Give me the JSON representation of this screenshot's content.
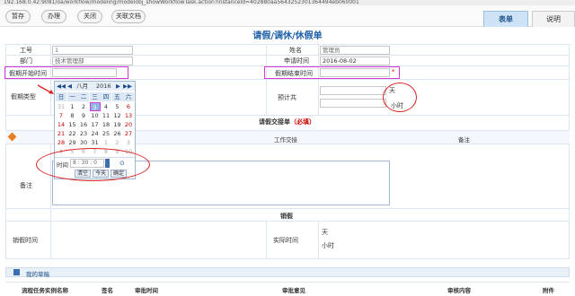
{
  "url": "192.168.0.42:9081/oa/workflow/modeling/modelobj_showWorkflowTask.action?instanceId=402880aa5643252301364494eb060001",
  "toolbar": {
    "buttons": [
      "暂存",
      "办理",
      "关闭",
      "关联文档"
    ],
    "tabs": [
      "表单",
      "说明"
    ]
  },
  "form": {
    "title": "请假/调休/休假单",
    "fields": {
      "job_no_label": "工号",
      "job_no_value": "1",
      "name_label": "姓名",
      "name_value": "管理员",
      "dept_label": "部门",
      "dept_value": "技术管理部",
      "apply_time_label": "申请时间",
      "apply_time_value": "2016-08-02",
      "start_label": "假期开始时间",
      "end_label": "假期结束时间",
      "end_marker": "*",
      "type_label": "假期类型",
      "estimate_label": "预计共",
      "unit_day": "天",
      "unit_hour": "小时",
      "handover_title": "请假交接单",
      "required_note": "（必填）",
      "col_work": "工作交接",
      "col_remark": "备注",
      "remark_label": "备注",
      "cancel_title": "销假",
      "cancel_time_label": "销假时间",
      "actual_time_label": "实际时间",
      "actual_day": "天",
      "actual_hour": "小时"
    }
  },
  "calendar": {
    "month_label": "八月",
    "year_label": "2016",
    "prev_year": "◀◀",
    "prev_month": "◀",
    "next_month": "▶",
    "next_year": "▶▶",
    "weekdays": [
      "日",
      "一",
      "二",
      "三",
      "四",
      "五",
      "六"
    ],
    "weeks": [
      [
        "31",
        "1",
        "2",
        "3",
        "4",
        "5",
        "6"
      ],
      [
        "7",
        "8",
        "9",
        "10",
        "11",
        "12",
        "13"
      ],
      [
        "14",
        "15",
        "16",
        "17",
        "18",
        "19",
        "20"
      ],
      [
        "21",
        "22",
        "23",
        "24",
        "25",
        "26",
        "27"
      ],
      [
        "28",
        "29",
        "30",
        "31",
        "1",
        "2",
        "3"
      ],
      [
        "4",
        "5",
        "6",
        "7",
        "8",
        "9",
        "10"
      ]
    ],
    "selected_day": "3",
    "time_label": "时间",
    "hour": "8",
    "minute": "30",
    "second": "0",
    "buttons": [
      "清空",
      "今天",
      "确定"
    ]
  },
  "bottom": {
    "section_label": "我的草稿",
    "headers": [
      "流程任务实例名称",
      "签名",
      "审批时间",
      "审批意见",
      "审核内容",
      "附件"
    ]
  }
}
